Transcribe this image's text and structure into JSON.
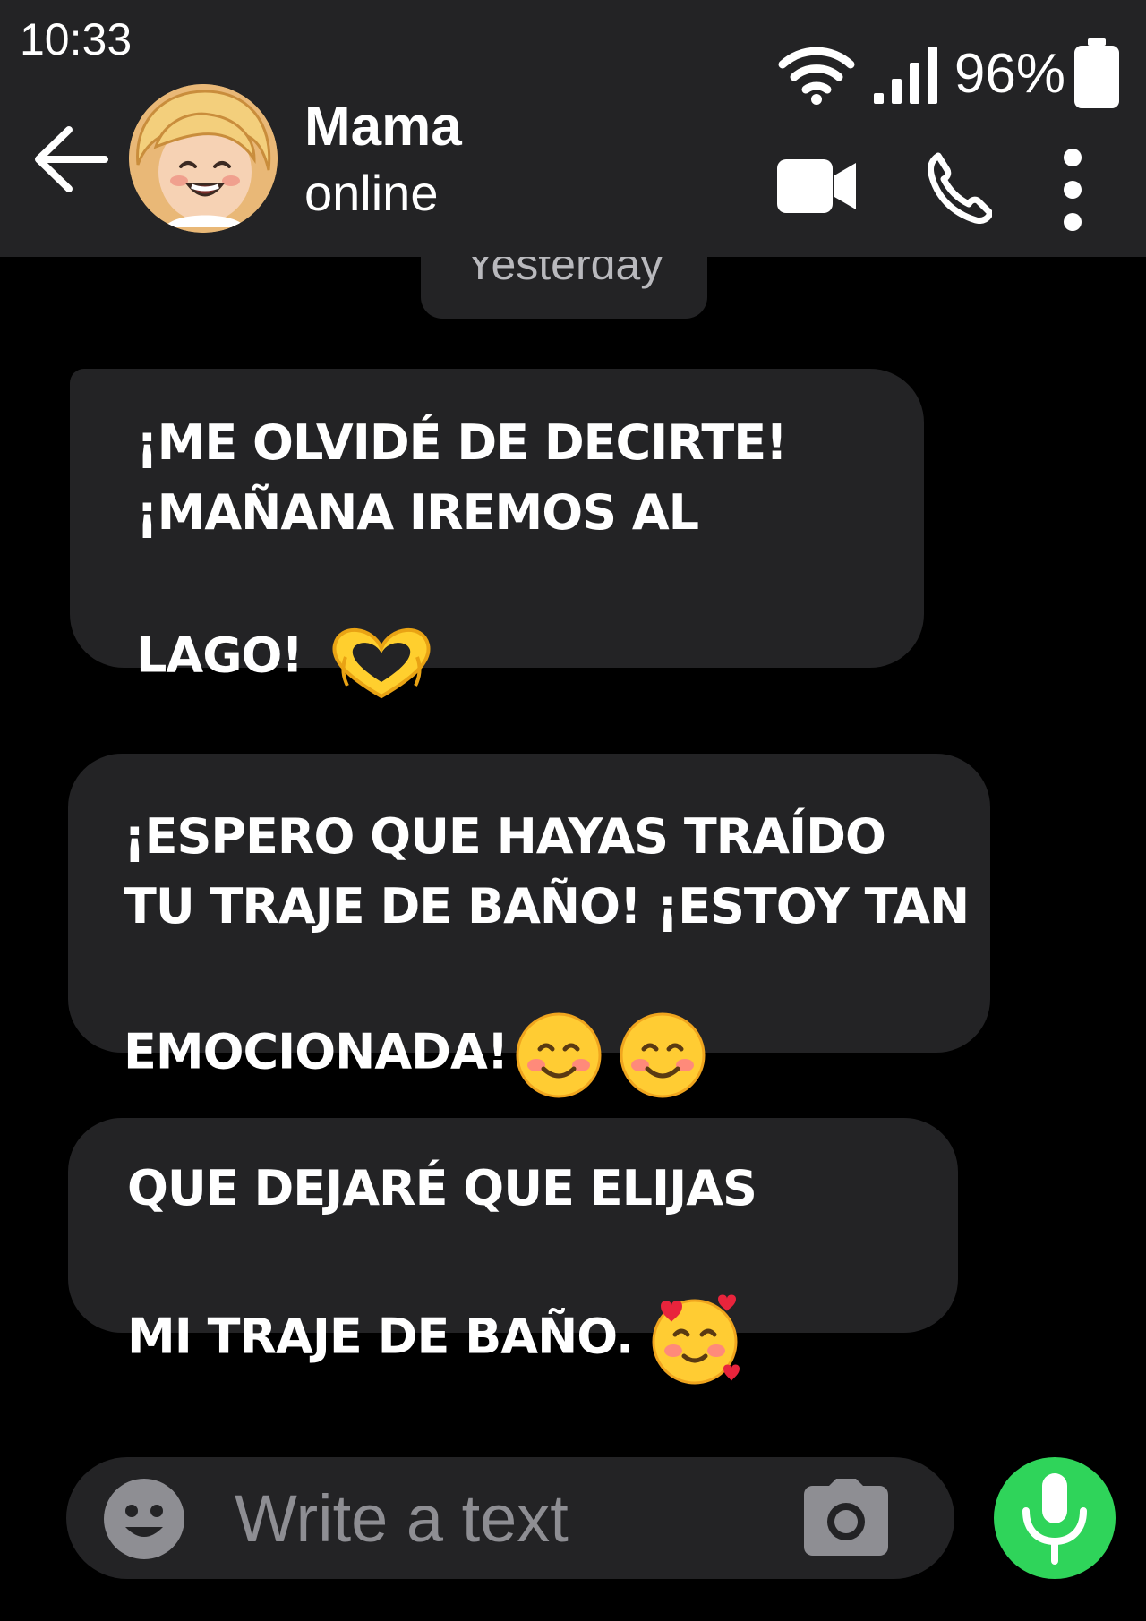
{
  "status_bar": {
    "time": "10:33",
    "battery_percent": "96%",
    "wifi_icon": "wifi-icon",
    "signal_icon": "signal-bars-icon",
    "battery_icon": "battery-icon"
  },
  "header": {
    "back_icon": "arrow-left-icon",
    "contact_name": "Mama",
    "contact_status": "online",
    "video_icon": "video-camera-icon",
    "call_icon": "phone-icon",
    "menu_icon": "more-vertical-icon"
  },
  "conversation": {
    "date_separator": "Yesterday",
    "messages": [
      {
        "text": "¡ME OLVIDÉ DE DECIRTE!\n¡MAÑANA IREMOS AL\nLAGO!",
        "emojis": [
          "heart-hands-emoji"
        ]
      },
      {
        "text": "¡ESPERO QUE HAYAS TRAÍDO\nTU TRAJE DE BAÑO! ¡ESTOY TAN\nEMOCIONADA!",
        "emojis": [
          "smiling-face-emoji",
          "smiling-face-emoji"
        ]
      },
      {
        "text": "QUE DEJARÉ QUE ELIJAS\nMI TRAJE DE BAÑO.",
        "emojis": [
          "smiling-face-with-hearts-emoji"
        ]
      }
    ]
  },
  "composer": {
    "placeholder": "Write a text",
    "value": "",
    "emoji_icon": "smiley-icon",
    "camera_icon": "camera-icon",
    "mic_icon": "microphone-icon"
  },
  "colors": {
    "background": "#000000",
    "header_background": "#232325",
    "bubble_background": "#232325",
    "mic_button": "#2fd45a",
    "placeholder_text": "#8e8e93"
  }
}
